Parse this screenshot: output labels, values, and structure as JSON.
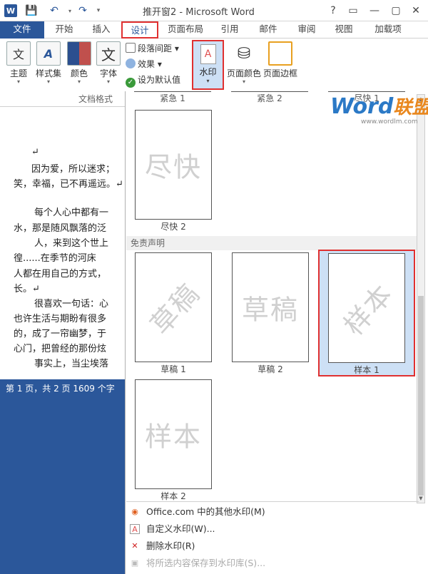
{
  "window": {
    "title": "推开窗2 - Microsoft Word",
    "app_icon": "W",
    "controls": [
      "?",
      "▭",
      "—",
      "▢",
      "✕"
    ]
  },
  "tabs": [
    "文件",
    "开始",
    "插入",
    "设计",
    "页面布局",
    "引用",
    "邮件",
    "审阅",
    "视图",
    "加载项"
  ],
  "ribbon": {
    "themes_label": "主题",
    "styles_label": "样式集",
    "colors_label": "颜色",
    "fonts_label": "字体",
    "para_spacing_label": "段落间距",
    "effects_label": "效果",
    "set_default_label": "设为默认值",
    "watermark_label": "水印",
    "page_color_label": "页面颜色",
    "page_borders_label": "页面边框",
    "group_label": "文档格式"
  },
  "document": {
    "paragraphs": [
      "↵",
      "因为爱，所以迷求；",
      "笑，幸福，已不再遥远。↵",
      "每个人心中都有一",
      "水，那是随风飘落的泛",
      "人，来到这个世上",
      "徨......在季节的河床",
      "人都在用自己的方式，",
      "长。↵",
      "很喜欢一句话：心",
      "也许生活与期盼有很多",
      "的，成了一帘幽梦，于",
      "心门，把曾经的那份炫",
      "事实上，当尘埃落"
    ]
  },
  "status": {
    "text": "第 1 页，共 2 页    1609 个字"
  },
  "gallery": {
    "partial_top": [
      "紧急 1",
      "紧急 2",
      "尽快 1"
    ],
    "items": [
      {
        "name": "尽快 2",
        "mark": "尽快"
      },
      {
        "name": "草稿 1",
        "mark": "草稿"
      },
      {
        "name": "草稿 2",
        "mark": "草稿"
      },
      {
        "name": "样本 1",
        "mark": "样本"
      },
      {
        "name": "样本 2",
        "mark": "样本"
      }
    ],
    "section_disclaimer": "免责声明"
  },
  "menu": {
    "more_online": "Office.com 中的其他水印(M)",
    "custom": "自定义水印(W)...",
    "remove": "删除水印(R)",
    "save_selection": "将所选内容保存到水印库(S)..."
  },
  "brand": {
    "main": "Word",
    "cn": "联盟",
    "url": "www.wordlm.com"
  }
}
